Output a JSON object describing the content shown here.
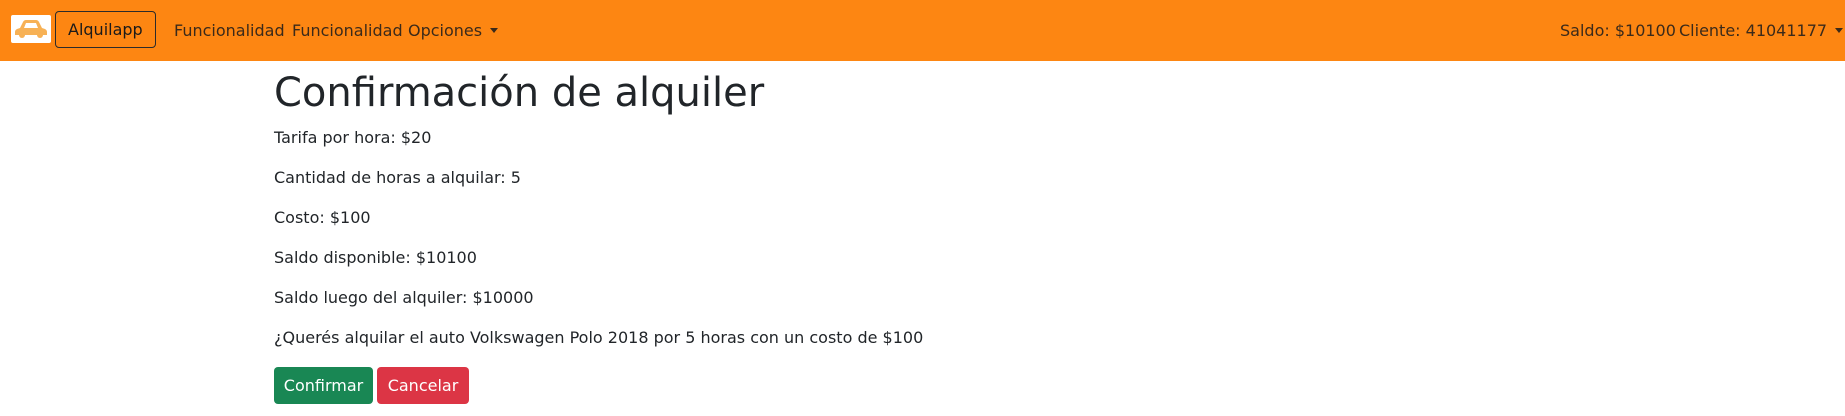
{
  "navbar": {
    "logo_icon": "car-icon",
    "brand": "Alquilapp",
    "links": [
      "Funcionalidad",
      "Funcionalidad"
    ],
    "dropdown": "Opciones",
    "balance": "Saldo: $10100",
    "client": "Cliente: 41041177"
  },
  "page": {
    "title": "Confirmación de alquiler",
    "lines": [
      "Tarifa por hora: $20",
      "Cantidad de horas a alquilar: 5",
      "Costo: $100",
      "Saldo disponible: $10100",
      "Saldo luego del alquiler: $10000",
      "¿Querés alquilar el auto Volkswagen Polo 2018 por 5 horas con un costo de $100"
    ],
    "confirm_label": "Confirmar",
    "cancel_label": "Cancelar"
  },
  "colors": {
    "navbar": "#fd8612",
    "confirm": "#198754",
    "cancel": "#dc3545"
  }
}
